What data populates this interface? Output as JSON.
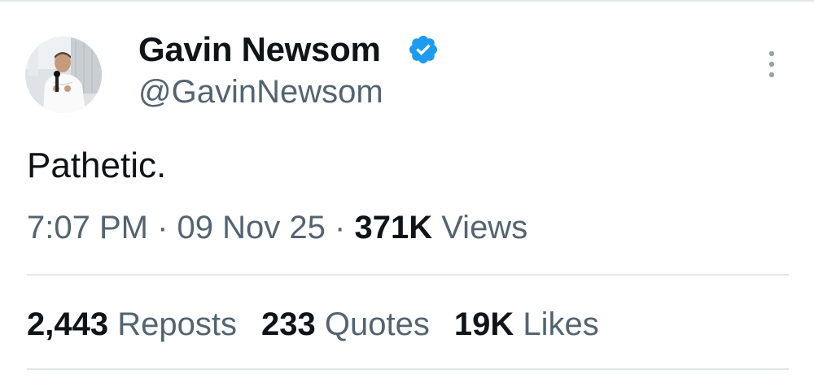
{
  "author": {
    "display_name": "Gavin Newsom",
    "handle": "@GavinNewsom",
    "verified_icon": "verified-badge-icon",
    "avatar": "profile-photo"
  },
  "tweet": {
    "text": "Pathetic.",
    "time": "7:07 PM",
    "separator": "·",
    "date": "09 Nov 25",
    "views_count": "371K",
    "views_label": "Views"
  },
  "stats": [
    {
      "count": "2,443",
      "label": "Reposts"
    },
    {
      "count": "233",
      "label": "Quotes"
    },
    {
      "count": "19K",
      "label": "Likes"
    }
  ],
  "colors": {
    "text_primary": "#0f1419",
    "text_secondary": "#536471",
    "verified_blue": "#1d9bf0",
    "divider": "#e4e7ea"
  }
}
